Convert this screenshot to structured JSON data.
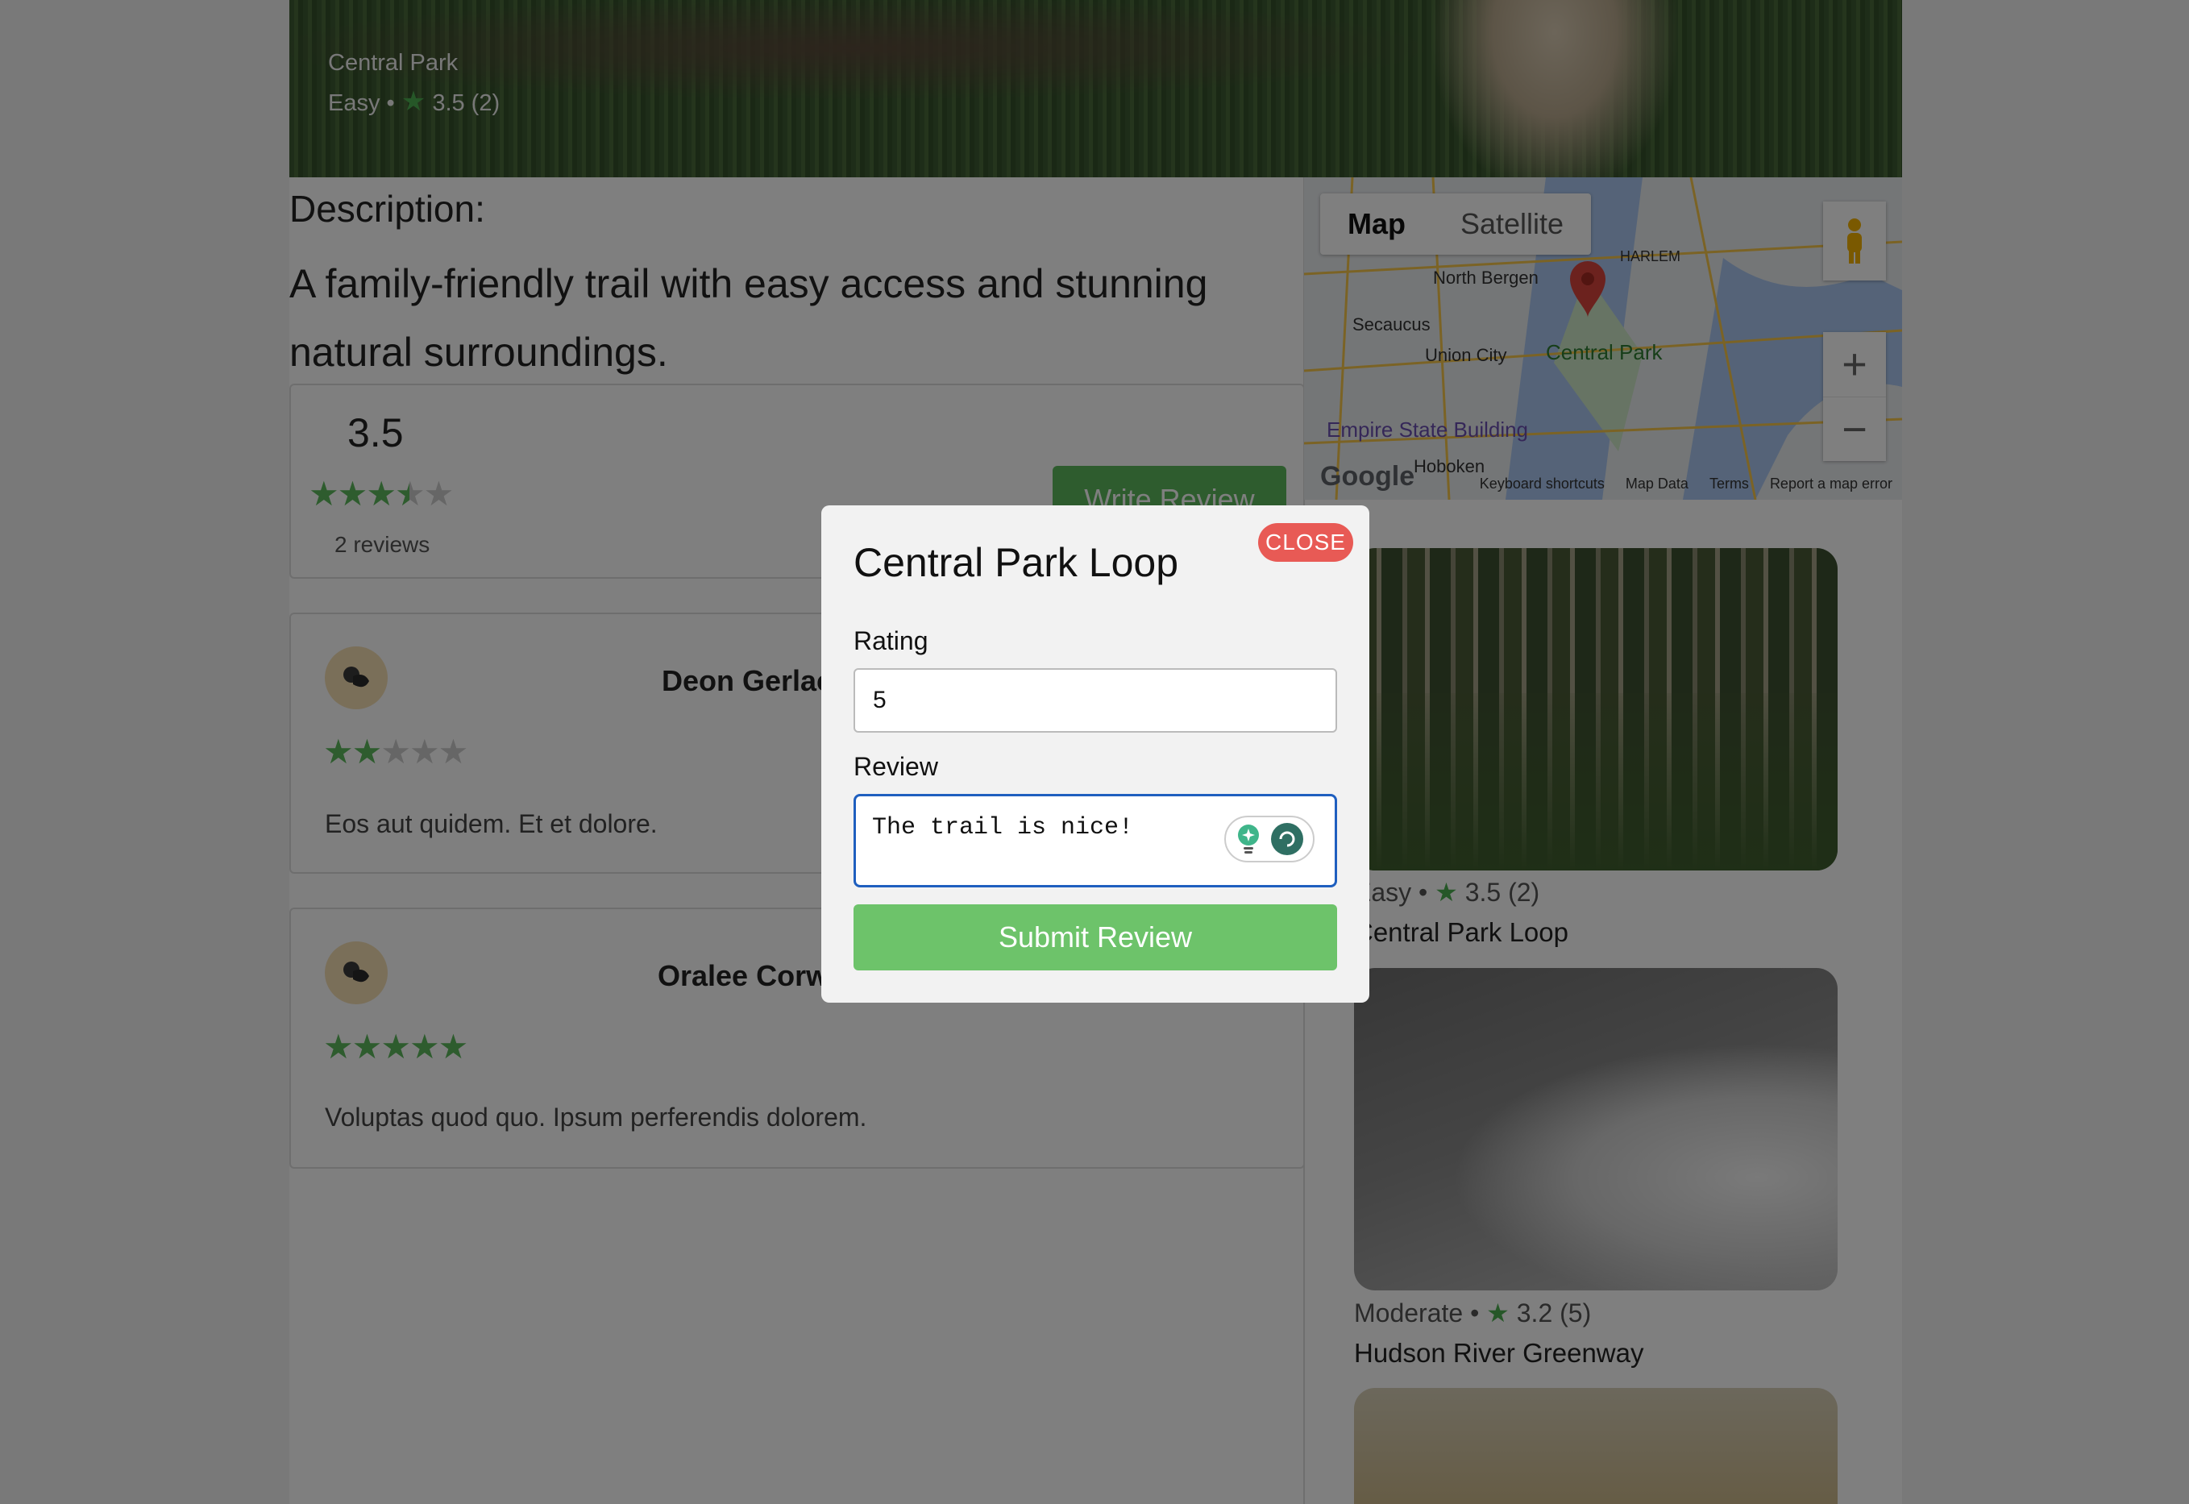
{
  "hero": {
    "location": "Central Park",
    "difficulty": "Easy",
    "rating_text": "3.5 (2)"
  },
  "description": {
    "title": "Description:",
    "body": "A family-friendly trail with easy access and stunning natural surroundings."
  },
  "summary": {
    "average": "3.5",
    "average_value": 3.5,
    "reviews_count": "2 reviews",
    "write_review_label": "Write Review"
  },
  "reviews": [
    {
      "name": "Deon Gerlach",
      "rating": 2,
      "text": "Eos aut quidem. Et et dolore."
    },
    {
      "name": "Oralee Corwin",
      "rating": 5,
      "text": "Voluptas quod quo. Ipsum perferendis dolorem."
    }
  ],
  "map": {
    "tab_map": "Map",
    "tab_satellite": "Satellite",
    "labels": {
      "north_bergen": "North Bergen",
      "secaucus": "Secaucus",
      "union_city": "Union City",
      "central_park": "Central Park",
      "empire": "Empire State Building",
      "hoboken": "Hoboken",
      "harlem": "HARLEM"
    },
    "footer": {
      "shortcuts": "Keyboard shortcuts",
      "map_data": "Map Data",
      "terms": "Terms",
      "report": "Report a map error"
    },
    "logo": "Google"
  },
  "trails": [
    {
      "difficulty": "Easy",
      "rating_text": "3.5 (2)",
      "name": "Central Park Loop"
    },
    {
      "difficulty": "Moderate",
      "rating_text": "3.2 (5)",
      "name": "Hudson River Greenway"
    }
  ],
  "modal": {
    "title": "Central Park Loop",
    "close_label": "CLOSE",
    "rating_label": "Rating",
    "rating_value": "5",
    "review_label": "Review",
    "review_value": "The trail is nice!",
    "submit_label": "Submit Review"
  },
  "colors": {
    "accent_green": "#5cb85c",
    "close_red": "#e85a55",
    "focus_blue": "#1f5fbf"
  }
}
